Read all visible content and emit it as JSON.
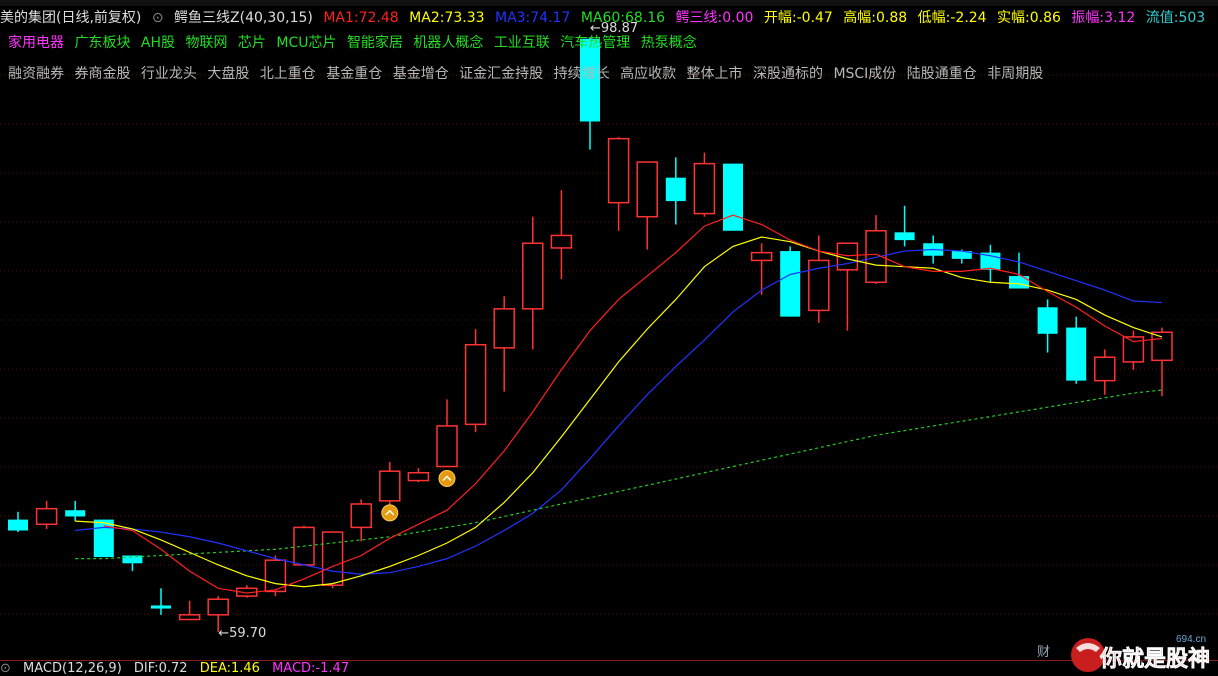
{
  "header": {
    "title": "美的集团(日线,前复权)",
    "indicator": "鳄鱼三线Z(40,30,15)",
    "ma1_label": "MA1:",
    "ma1_value": "72.48",
    "ma2_label": "MA2:",
    "ma2_value": "73.33",
    "ma3_label": "MA3:",
    "ma3_value": "74.17",
    "ma60_label": "MA60:",
    "ma60_value": "68.16",
    "crocodile_label": "鳄三线:",
    "crocodile_value": "0.00",
    "open_label": "开幅:",
    "open_value": "-0.47",
    "high_label": "高幅:",
    "high_value": "0.88",
    "low_label": "低幅:",
    "low_value": "-2.24",
    "real_label": "实幅:",
    "real_value": "0.86",
    "amp_label": "振幅:",
    "amp_value": "3.12",
    "float_label": "流值:",
    "float_value": "503"
  },
  "concept_tags": [
    "家用电器",
    "广东板块",
    "AH股",
    "物联网",
    "芯片",
    "MCU芯片",
    "智能家居",
    "机器人概念",
    "工业互联",
    "汽车热管理",
    "热泵概念"
  ],
  "feature_tags": [
    "融资融券",
    "券商金股",
    "行业龙头",
    "大盘股",
    "北上重仓",
    "基金重仓",
    "基金增仓",
    "证金汇金持股",
    "持续增长",
    "高应收款",
    "整体上市",
    "深股通标的",
    "MSCI成份",
    "陆股通重仓",
    "非周期股"
  ],
  "macd": {
    "label": "MACD(12,26,9)",
    "dif_label": "DIF:",
    "dif_value": "0.72",
    "dea_label": "DEA:",
    "dea_value": "1.46",
    "macd_label": "MACD:",
    "macd_value": "-1.47"
  },
  "watermark": {
    "brand": "你就是股神",
    "site": "694.cn"
  },
  "finance_icon_label": "财",
  "colors": {
    "up": "#ff3333",
    "down": "#00ffff",
    "ma1": "#ff2020",
    "ma2": "#ffff00",
    "ma3": "#2233ff",
    "ma60": "#22cc22"
  },
  "chart_data": {
    "type": "candlestick",
    "y_axis_visible": false,
    "candles": [
      {
        "o": 66.9,
        "h": 67.4,
        "l": 66.1,
        "c": 66.2
      },
      {
        "o": 66.6,
        "h": 68.1,
        "l": 66.3,
        "c": 67.6
      },
      {
        "o": 67.5,
        "h": 68.1,
        "l": 66.8,
        "c": 67.1
      },
      {
        "o": 66.9,
        "h": 66.9,
        "l": 64.5,
        "c": 64.5
      },
      {
        "o": 64.6,
        "h": 64.6,
        "l": 63.6,
        "c": 64.1
      },
      {
        "o": 61.4,
        "h": 62.5,
        "l": 60.8,
        "c": 61.2
      },
      {
        "o": 60.5,
        "h": 61.7,
        "l": 60.5,
        "c": 60.8
      },
      {
        "o": 60.8,
        "h": 62.0,
        "l": 59.7,
        "c": 61.8
      },
      {
        "o": 62.0,
        "h": 62.7,
        "l": 61.9,
        "c": 62.5
      },
      {
        "o": 62.3,
        "h": 64.6,
        "l": 62.0,
        "c": 64.3
      },
      {
        "o": 64.0,
        "h": 66.5,
        "l": 64.0,
        "c": 66.4
      },
      {
        "o": 62.7,
        "h": 66.1,
        "l": 62.5,
        "c": 66.1
      },
      {
        "o": 66.4,
        "h": 68.2,
        "l": 65.5,
        "c": 67.9
      },
      {
        "o": 68.1,
        "h": 70.6,
        "l": 67.0,
        "c": 70.0
      },
      {
        "o": 69.4,
        "h": 70.2,
        "l": 69.3,
        "c": 69.9
      },
      {
        "o": 70.3,
        "h": 74.6,
        "l": 70.3,
        "c": 72.9
      },
      {
        "o": 73.0,
        "h": 79.1,
        "l": 72.5,
        "c": 78.1
      },
      {
        "o": 77.9,
        "h": 81.2,
        "l": 75.1,
        "c": 80.4
      },
      {
        "o": 80.4,
        "h": 86.3,
        "l": 77.8,
        "c": 84.6
      },
      {
        "o": 84.3,
        "h": 88.0,
        "l": 82.3,
        "c": 85.1
      },
      {
        "o": 97.7,
        "h": 97.8,
        "l": 90.6,
        "c": 92.4
      },
      {
        "o": 87.2,
        "h": 91.4,
        "l": 85.4,
        "c": 91.3
      },
      {
        "o": 86.3,
        "h": 89.8,
        "l": 84.2,
        "c": 89.8
      },
      {
        "o": 88.8,
        "h": 90.1,
        "l": 85.8,
        "c": 87.3
      },
      {
        "o": 86.5,
        "h": 90.4,
        "l": 86.3,
        "c": 89.7
      },
      {
        "o": 89.7,
        "h": 89.7,
        "l": 85.4,
        "c": 85.4
      },
      {
        "o": 83.5,
        "h": 84.6,
        "l": 81.3,
        "c": 84.0
      },
      {
        "o": 84.1,
        "h": 84.4,
        "l": 79.9,
        "c": 79.9
      },
      {
        "o": 80.3,
        "h": 85.1,
        "l": 79.5,
        "c": 83.5
      },
      {
        "o": 82.9,
        "h": 83.9,
        "l": 79.0,
        "c": 84.6
      },
      {
        "o": 82.1,
        "h": 86.4,
        "l": 82.0,
        "c": 85.4
      },
      {
        "o": 85.3,
        "h": 87.0,
        "l": 84.4,
        "c": 84.8
      },
      {
        "o": 84.6,
        "h": 85.1,
        "l": 83.3,
        "c": 83.8
      },
      {
        "o": 84.1,
        "h": 84.2,
        "l": 83.3,
        "c": 83.6
      },
      {
        "o": 84.0,
        "h": 84.5,
        "l": 82.1,
        "c": 82.9
      },
      {
        "o": 82.5,
        "h": 84.0,
        "l": 81.9,
        "c": 81.7
      },
      {
        "o": 80.5,
        "h": 81.0,
        "l": 77.6,
        "c": 78.8
      },
      {
        "o": 79.2,
        "h": 79.9,
        "l": 75.6,
        "c": 75.8
      },
      {
        "o": 75.8,
        "h": 77.8,
        "l": 74.9,
        "c": 77.3
      },
      {
        "o": 77.0,
        "h": 79.0,
        "l": 76.5,
        "c": 78.6
      },
      {
        "o": 77.1,
        "h": 79.2,
        "l": 74.8,
        "c": 78.9
      }
    ],
    "ma1": [
      null,
      null,
      null,
      66.5,
      66.2,
      65.0,
      63.6,
      62.5,
      62.2,
      62.4,
      63.1,
      63.9,
      64.6,
      65.7,
      66.6,
      67.5,
      69.2,
      71.3,
      73.8,
      76.5,
      79.0,
      81.0,
      82.5,
      84.0,
      85.7,
      86.4,
      85.8,
      84.8,
      84.1,
      83.8,
      83.9,
      83.1,
      82.8,
      82.8,
      83.0,
      82.6,
      81.5,
      80.5,
      79.3,
      78.3,
      78.5
    ],
    "ma2": [
      null,
      null,
      66.8,
      66.7,
      66.3,
      65.6,
      64.8,
      64.0,
      63.3,
      62.8,
      62.6,
      62.8,
      63.3,
      63.9,
      64.6,
      65.4,
      66.4,
      68.0,
      69.9,
      72.2,
      74.6,
      77.0,
      79.1,
      81.0,
      83.1,
      84.4,
      85.0,
      84.7,
      84.1,
      83.6,
      83.2,
      83.1,
      83.0,
      82.4,
      82.1,
      82.0,
      81.6,
      81.0,
      80.0,
      79.2,
      78.6
    ],
    "ma3": [
      null,
      null,
      66.2,
      66.4,
      66.3,
      66.1,
      65.8,
      65.4,
      64.9,
      64.4,
      64.0,
      63.6,
      63.4,
      63.5,
      63.9,
      64.4,
      65.2,
      66.2,
      67.3,
      68.8,
      70.8,
      72.9,
      74.9,
      76.7,
      78.4,
      80.2,
      81.6,
      82.6,
      83.0,
      83.3,
      83.7,
      84.1,
      84.2,
      84.1,
      83.8,
      83.4,
      82.8,
      82.2,
      81.6,
      80.9,
      80.8
    ],
    "ma60": [
      null,
      null,
      64.4,
      64.4,
      64.5,
      64.6,
      64.7,
      64.8,
      64.9,
      65.0,
      65.2,
      65.4,
      65.6,
      65.8,
      66.1,
      66.4,
      66.7,
      67.1,
      67.5,
      67.9,
      68.3,
      68.7,
      69.1,
      69.5,
      69.9,
      70.3,
      70.7,
      71.1,
      71.5,
      71.9,
      72.3,
      72.6,
      72.9,
      73.2,
      73.5,
      73.8,
      74.1,
      74.4,
      74.7,
      75.0,
      75.2
    ],
    "annotations": [
      {
        "text": "59.70",
        "candle": 7,
        "at": "low"
      },
      {
        "text": "98.87",
        "candle": 20,
        "at": "high"
      }
    ],
    "buy_signals": [
      13,
      15
    ]
  }
}
